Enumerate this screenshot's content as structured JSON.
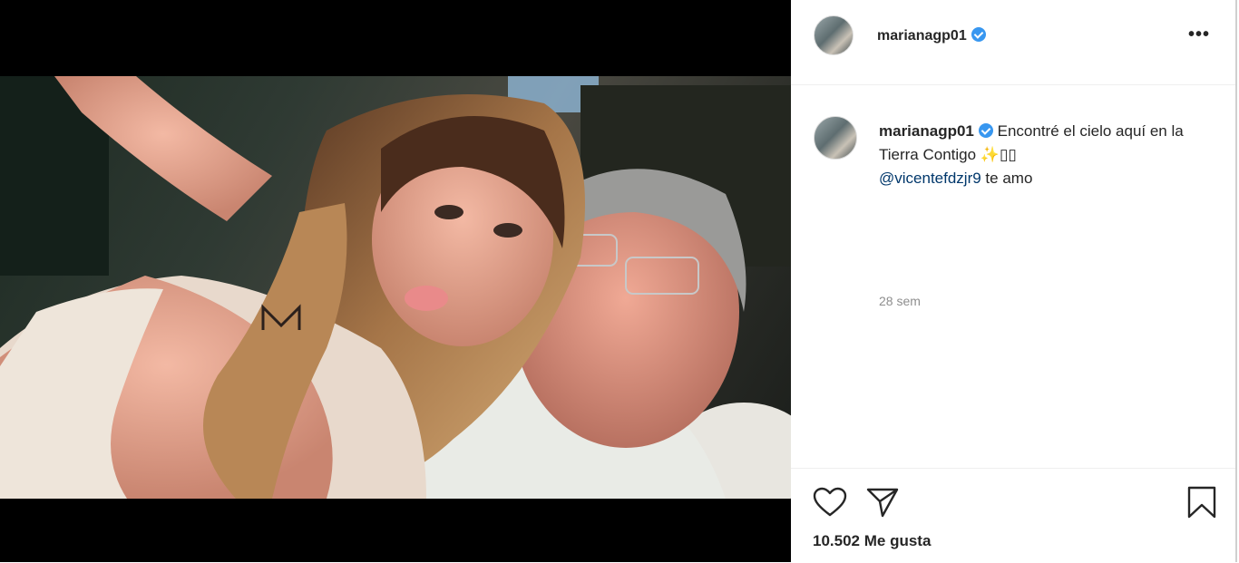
{
  "post": {
    "author": "marianagp01",
    "verified": true,
    "more_label": "•••",
    "caption_text": "Encontré el cielo aquí en la Tierra Contigo",
    "caption_emoji": "✨",
    "caption_boxes": "▯▯",
    "mention": "@vicentefdzjr9",
    "caption_tail": " te amo",
    "time_ago": "28 sem",
    "likes_count": "10.502",
    "likes_label": "Me gusta"
  },
  "icons": {
    "like": "heart-icon",
    "share": "paper-plane-icon",
    "save": "bookmark-icon",
    "verified": "verified-badge-icon",
    "more": "more-options-icon"
  },
  "colors": {
    "verified": "#3897f0",
    "mention": "#00376b",
    "muted": "#8e8e8e",
    "text": "#262626"
  }
}
